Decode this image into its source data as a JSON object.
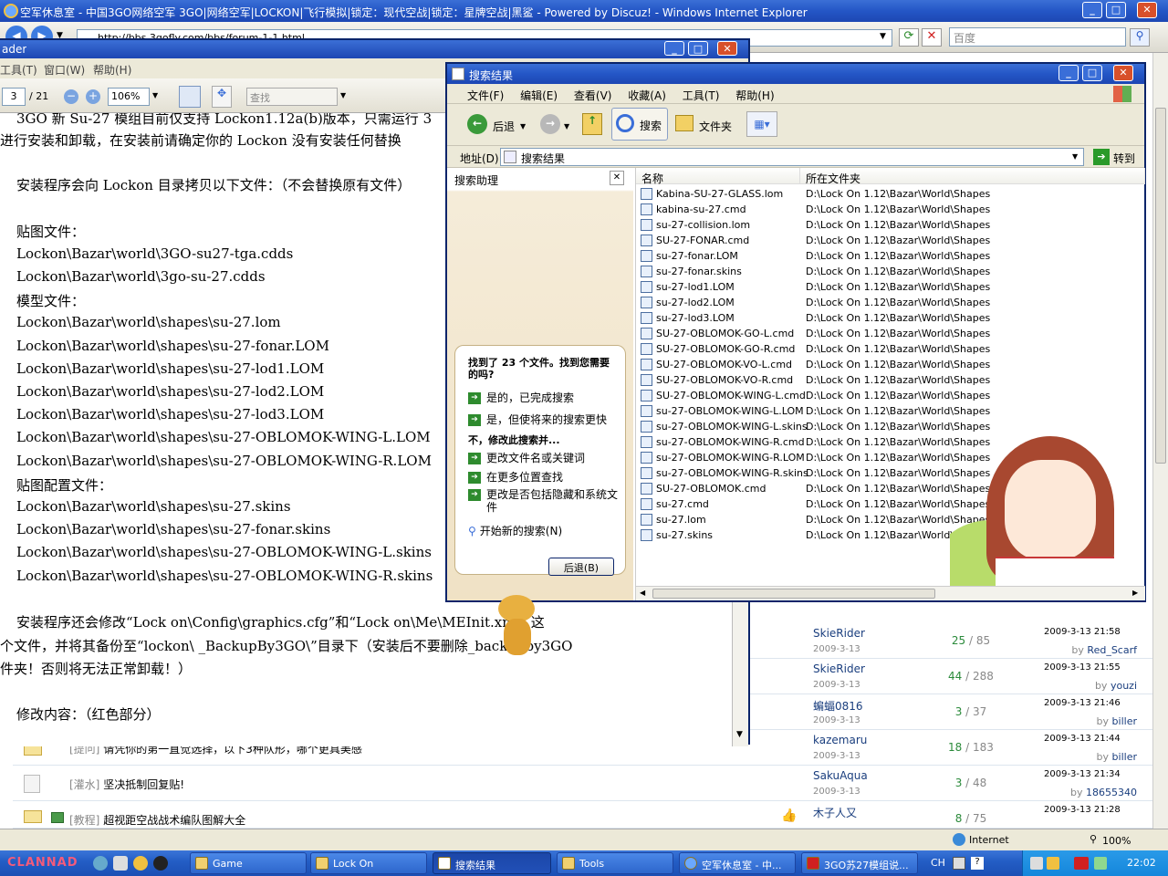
{
  "ie": {
    "title": "空军休息室 - 中国3GO网络空军 3GO|网络空军|LOCKON|飞行模拟|锁定：现代空战|锁定：星牌空战|黑鲨 - Powered by Discuz! - Windows Internet Explorer",
    "address": "http://bbs.3gofly.com/bbs/forum-1-1.html",
    "search_placeholder": "百度",
    "status_zone": "Internet",
    "zoom": "100%"
  },
  "forum_rows": [
    {
      "tag": "",
      "title": "",
      "author": "SkieRider",
      "author_date": "2009-3-13",
      "replies": "25",
      "views": "85",
      "last_date": "2009-3-13 21:58",
      "last_by": "Red_Scarf"
    },
    {
      "tag": "",
      "title": "",
      "author": "SkieRider",
      "author_date": "2009-3-13",
      "replies": "44",
      "views": "288",
      "last_date": "2009-3-13 21:55",
      "last_by": "youzi"
    },
    {
      "tag": "",
      "title": "",
      "author": "蝙蝠0816",
      "author_date": "2009-3-13",
      "replies": "3",
      "views": "37",
      "last_date": "2009-3-13 21:46",
      "last_by": "biller"
    },
    {
      "tag": "[提问]",
      "title": "请凭你的第一直觉选择，以下3种队形，哪个更具美感",
      "author": "kazemaru",
      "author_date": "2009-3-13",
      "replies": "18",
      "views": "183",
      "last_date": "2009-3-13 21:44",
      "last_by": "biller"
    },
    {
      "tag": "[灌水]",
      "title": "坚决抵制回复贴!",
      "author": "SakuAqua",
      "author_date": "2009-3-13",
      "replies": "3",
      "views": "48",
      "last_date": "2009-3-13 21:34",
      "last_by": "18655340"
    },
    {
      "tag": "[教程]",
      "title": "超视距空战战术编队图解大全",
      "author": "木子人又",
      "author_date": "2009-3-13",
      "replies": "8",
      "views": "75",
      "last_date": "2009-3-13 21:28",
      "last_by": ""
    }
  ],
  "reader": {
    "title": "ader",
    "menu": [
      "工具(T)",
      "窗口(W)",
      "帮助(H)"
    ],
    "page": "3",
    "page_total": "/ 21",
    "zoom": "106%",
    "find": "查找",
    "lines": [
      "3GO 新 Su-27 模组目前仅支持 Lockon1.12a(b)版本，只需运行 3",
      "进行安装和卸载，在安装前请确定你的 Lockon 没有安装任何替换",
      "",
      "安装程序会向 Lockon 目录拷贝以下文件：（不会替换原有文件）",
      "",
      "贴图文件：",
      "Lockon\\Bazar\\world\\3GO-su27-tga.cdds",
      "Lockon\\Bazar\\world\\3go-su-27.cdds",
      "模型文件：",
      "Lockon\\Bazar\\world\\shapes\\su-27.lom",
      "Lockon\\Bazar\\world\\shapes\\su-27-fonar.LOM",
      "Lockon\\Bazar\\world\\shapes\\su-27-lod1.LOM",
      "Lockon\\Bazar\\world\\shapes\\su-27-lod2.LOM",
      "Lockon\\Bazar\\world\\shapes\\su-27-lod3.LOM",
      "Lockon\\Bazar\\world\\shapes\\su-27-OBLOMOK-WING-L.LOM",
      "Lockon\\Bazar\\world\\shapes\\su-27-OBLOMOK-WING-R.LOM",
      "贴图配置文件：",
      "Lockon\\Bazar\\world\\shapes\\su-27.skins",
      "Lockon\\Bazar\\world\\shapes\\su-27-fonar.skins",
      "Lockon\\Bazar\\world\\shapes\\su-27-OBLOMOK-WING-L.skins",
      "Lockon\\Bazar\\world\\shapes\\su-27-OBLOMOK-WING-R.skins",
      "",
      "安装程序还会修改“Lock on\\Config\\graphics.cfg”和“Lock on\\Me\\MEInit.xml” 这",
      "个文件，并将其备份至“lockon\\ _BackupBy3GO\\”目录下（安装后不要删除_backupby3GO",
      "件夹！否则将无法正常卸载！）",
      "",
      "修改内容：（红色部分）"
    ]
  },
  "search": {
    "title": "搜索结果",
    "menu": [
      "文件(F)",
      "编辑(E)",
      "查看(V)",
      "收藏(A)",
      "工具(T)",
      "帮助(H)"
    ],
    "back": "后退",
    "search_btn": "搜索",
    "folders_btn": "文件夹",
    "address_label": "地址(D)",
    "address_value": "搜索结果",
    "go": "转到",
    "assistant_title": "搜索助理",
    "found_text": "找到了 23 个文件。找到您需要的吗?",
    "opt_done": "是的，已完成搜索",
    "opt_faster": "是，但使将来的搜索更快",
    "no_refine": "不，修改此搜索并...",
    "opt_change_name": "更改文件名或关键词",
    "opt_more_places": "在更多位置查找",
    "opt_hidden": "更改是否包括隐藏和系统文件",
    "new_search": "开始新的搜索(N)",
    "back_btn": "后退(B)",
    "col_name": "名称",
    "col_folder": "所在文件夹",
    "folder_path": "D:\\Lock On 1.12\\Bazar\\World\\Shapes",
    "files": [
      "Kabina-SU-27-GLASS.lom",
      "kabina-su-27.cmd",
      "su-27-collision.lom",
      "SU-27-FONAR.cmd",
      "su-27-fonar.LOM",
      "su-27-fonar.skins",
      "su-27-lod1.LOM",
      "su-27-lod2.LOM",
      "su-27-lod3.LOM",
      "SU-27-OBLOMOK-GO-L.cmd",
      "SU-27-OBLOMOK-GO-R.cmd",
      "SU-27-OBLOMOK-VO-L.cmd",
      "SU-27-OBLOMOK-VO-R.cmd",
      "SU-27-OBLOMOK-WING-L.cmd",
      "su-27-OBLOMOK-WING-L.LOM",
      "su-27-OBLOMOK-WING-L.skins",
      "su-27-OBLOMOK-WING-R.cmd",
      "su-27-OBLOMOK-WING-R.LOM",
      "su-27-OBLOMOK-WING-R.skins",
      "SU-27-OBLOMOK.cmd",
      "su-27.cmd",
      "su-27.lom",
      "su-27.skins"
    ]
  },
  "taskbar": {
    "start": "CLANNAD",
    "items": [
      "Game",
      "Lock On",
      "搜索结果",
      "Tools",
      "空军休息室 - 中...",
      "3GO苏27模组说..."
    ],
    "lang": "CH",
    "clock": "22:02"
  }
}
